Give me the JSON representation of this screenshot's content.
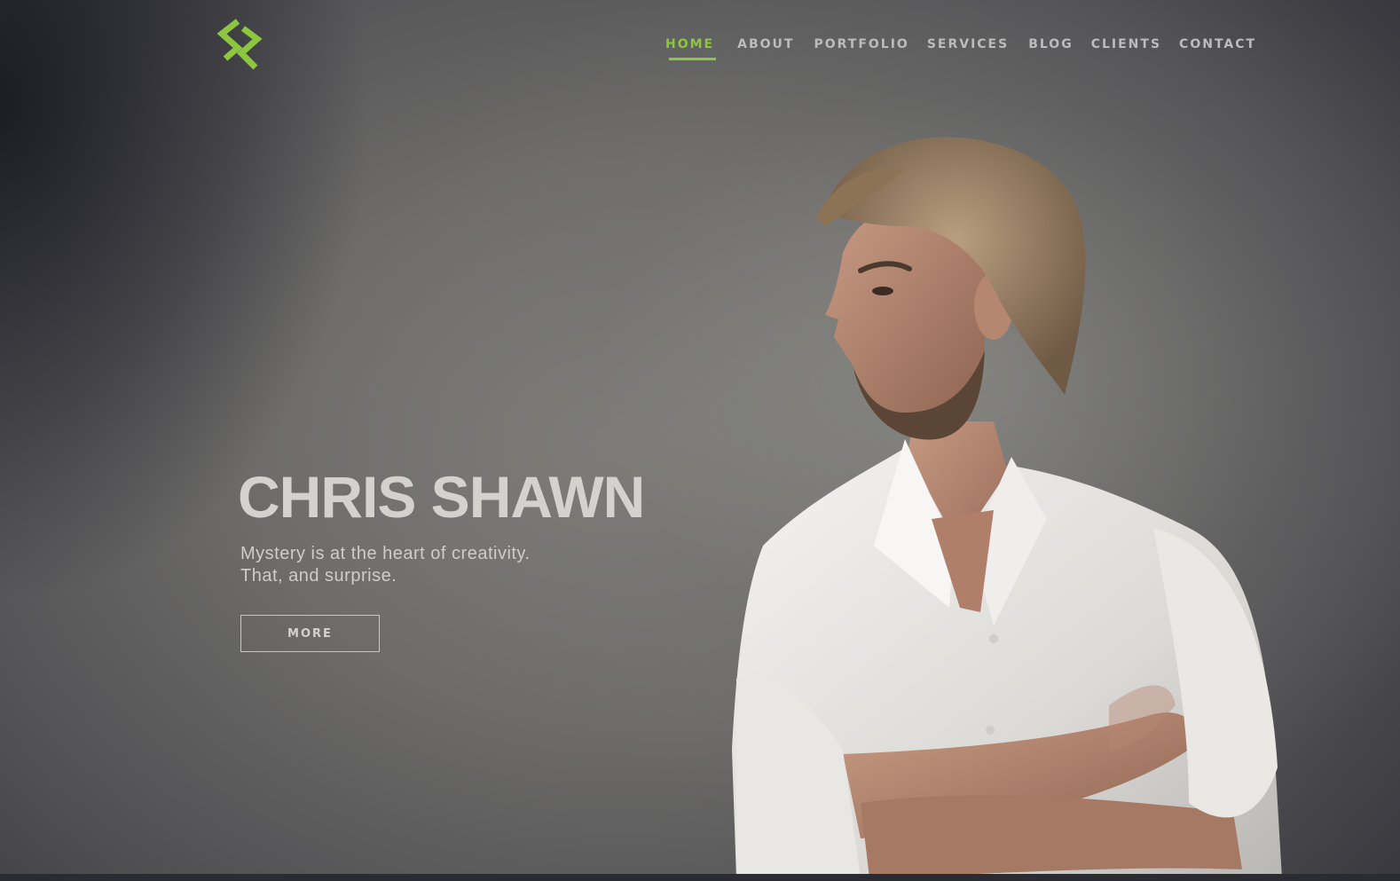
{
  "brand": {
    "logo_icon": "cs-monogram-icon",
    "accent_color": "#8dc63f"
  },
  "nav": {
    "items": [
      {
        "label": "HOME",
        "active": true
      },
      {
        "label": "ABOUT",
        "active": false
      },
      {
        "label": "PORTFOLIO",
        "active": false
      },
      {
        "label": "SERVICES",
        "active": false
      },
      {
        "label": "BLOG",
        "active": false
      },
      {
        "label": "CLIENTS",
        "active": false
      },
      {
        "label": "CONTACT",
        "active": false
      }
    ]
  },
  "hero": {
    "title": "CHRIS SHAWN",
    "tagline_line1": "Mystery is at the heart of creativity.",
    "tagline_line2": "That, and surprise.",
    "button_label": "MORE",
    "image": "man-portrait-crossed-arms"
  }
}
